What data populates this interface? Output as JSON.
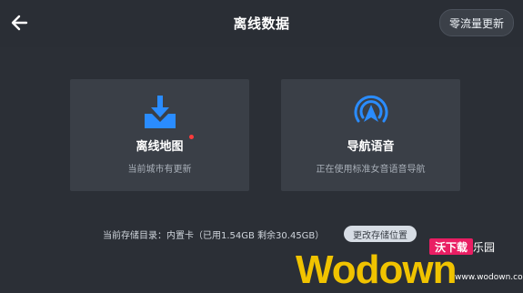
{
  "header": {
    "title": "离线数据",
    "right_button": "零流量更新",
    "back_icon": "back-arrow-icon"
  },
  "cards": [
    {
      "label": "离线地图",
      "subtitle": "当前城市有更新",
      "icon": "download-map-icon",
      "badge_color": "#ff3b3b"
    },
    {
      "label": "导航语音",
      "subtitle": "正在使用标准女音语音导航",
      "icon": "voice-navigation-icon"
    }
  ],
  "storage": {
    "text": "当前存储目录：内置卡（已用1.54GB 剩余30.45GB）",
    "button": "更改存储位置"
  },
  "watermark": {
    "main": "Wodown",
    "badge": "沃下载",
    "small": "乐园",
    "url": "www.wodown.com"
  },
  "colors": {
    "accent": "#2a8cff",
    "background": "#2b2f36",
    "card": "#3a3f47"
  }
}
